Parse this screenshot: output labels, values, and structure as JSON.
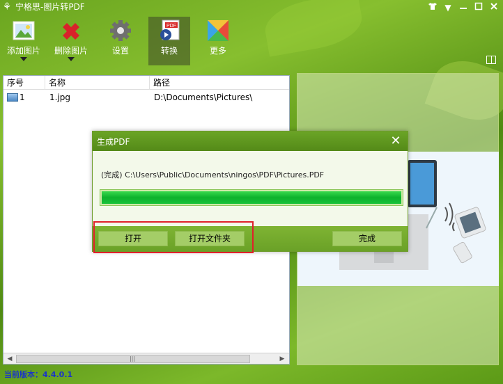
{
  "app": {
    "title": "宁格思-图片转PDF"
  },
  "toolbar": {
    "items": [
      {
        "label": "添加图片",
        "icon": "add-image-icon"
      },
      {
        "label": "删除图片",
        "icon": "delete-image-icon"
      },
      {
        "label": "设置",
        "icon": "gear-icon"
      },
      {
        "label": "转换",
        "icon": "convert-pdf-icon"
      },
      {
        "label": "更多",
        "icon": "more-icon"
      }
    ]
  },
  "filelist": {
    "columns": [
      "序号",
      "名称",
      "路径"
    ],
    "rows": [
      {
        "index": "1",
        "name": "1.jpg",
        "path": "D:\\Documents\\Pictures\\"
      }
    ]
  },
  "dialog": {
    "title": "生成PDF",
    "message": "(完成) C:\\Users\\Public\\Documents\\ningos\\PDF\\Pictures.PDF",
    "progress": 1.0,
    "buttons": {
      "open": "打开",
      "open_folder": "打开文件夹",
      "done": "完成"
    }
  },
  "status": {
    "version": "当前版本：4.4.0.1"
  },
  "colors": {
    "accent": "#5c9a17",
    "progress": "#0db22c",
    "highlight": "#e0202a",
    "status_text": "#1a34c8"
  }
}
